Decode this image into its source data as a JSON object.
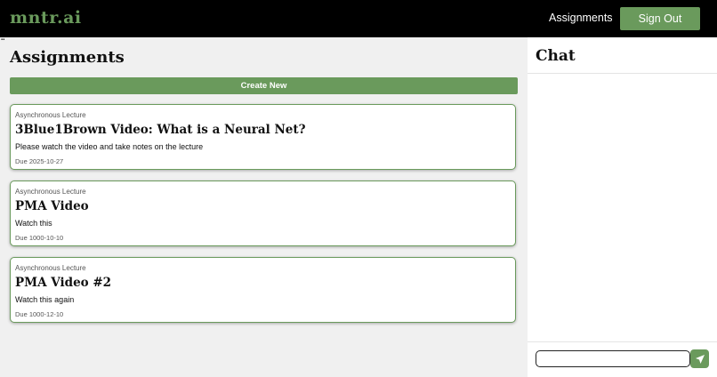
{
  "header": {
    "logo": "mntr.ai",
    "nav_assignments": "Assignments",
    "sign_out_label": "Sign Out"
  },
  "main": {
    "title": "Assignments",
    "create_label": "Create New",
    "assignments": [
      {
        "type": "Asynchronous Lecture",
        "title": "3Blue1Brown Video: What is a Neural Net?",
        "description": "Please watch the video and take notes on the lecture",
        "due": "Due 2025-10-27"
      },
      {
        "type": "Asynchronous Lecture",
        "title": "PMA Video",
        "description": "Watch this",
        "due": "Due 1000-10-10"
      },
      {
        "type": "Asynchronous Lecture",
        "title": "PMA Video #2",
        "description": "Watch this again",
        "due": "Due 1000-12-10"
      }
    ]
  },
  "chat": {
    "title": "Chat",
    "input_value": "",
    "send_icon": "send-icon"
  },
  "colors": {
    "accent": "#6a9a5c",
    "header_bg": "#000000",
    "main_bg": "#f0f0f0"
  }
}
